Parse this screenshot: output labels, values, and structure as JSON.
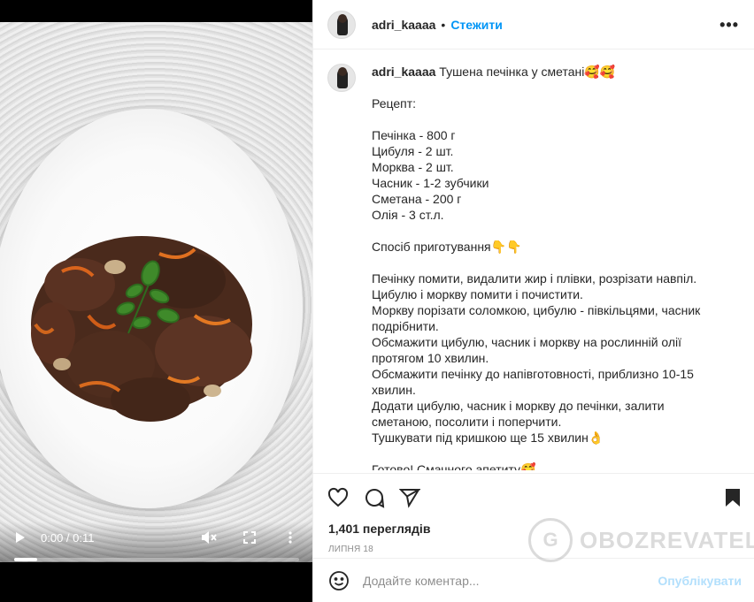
{
  "post": {
    "username": "adri_kaaaa",
    "separator": "•",
    "follow_label": "Стежити",
    "more_label": "•••"
  },
  "caption": {
    "username": "adri_kaaaa",
    "title": "Тушена печінка у сметані🥰🥰",
    "lines": [
      "",
      "Рецепт:",
      "",
      "Печінка - 800 г",
      "Цибуля - 2 шт.",
      "Морква - 2 шт.",
      "Часник - 1-2 зубчики",
      "Сметана - 200 г",
      "Олія - 3 ст.л.",
      "",
      "Спосіб приготування👇👇",
      "",
      "Печінку помити, видалити жир і плівки, розрізати навпіл.",
      "Цибулю і моркву помити і почистити.",
      "Моркву порізати соломкою, цибулю - півкільцями, часник",
      "подрібнити.",
      "Обсмажити цибулю, часник і моркву на рослинній олії",
      "протягом 10 хвилин.",
      "Обсмажити печінку до напівготовності, приблизно 10-15",
      "хвилин.",
      "Додати цибулю, часник і моркву до печінки, залити",
      "сметаною, посолити і поперчити.",
      "Тушкувати під кришкою ще 15 хвилин👌",
      "",
      "Готово! Смачного апетиту🥰"
    ]
  },
  "video": {
    "time": "0:00 / 0:11",
    "progress": 0.08,
    "icons": [
      "play-icon",
      "mute-icon",
      "fullscreen-icon",
      "more-vert-icon"
    ]
  },
  "stats": {
    "views": "1,401 переглядів",
    "date": "ЛИПНЯ 18"
  },
  "comment": {
    "placeholder": "Додайте коментар...",
    "post_label": "Опублікувати"
  },
  "watermark": {
    "brand": "OBOZREVATEL"
  }
}
